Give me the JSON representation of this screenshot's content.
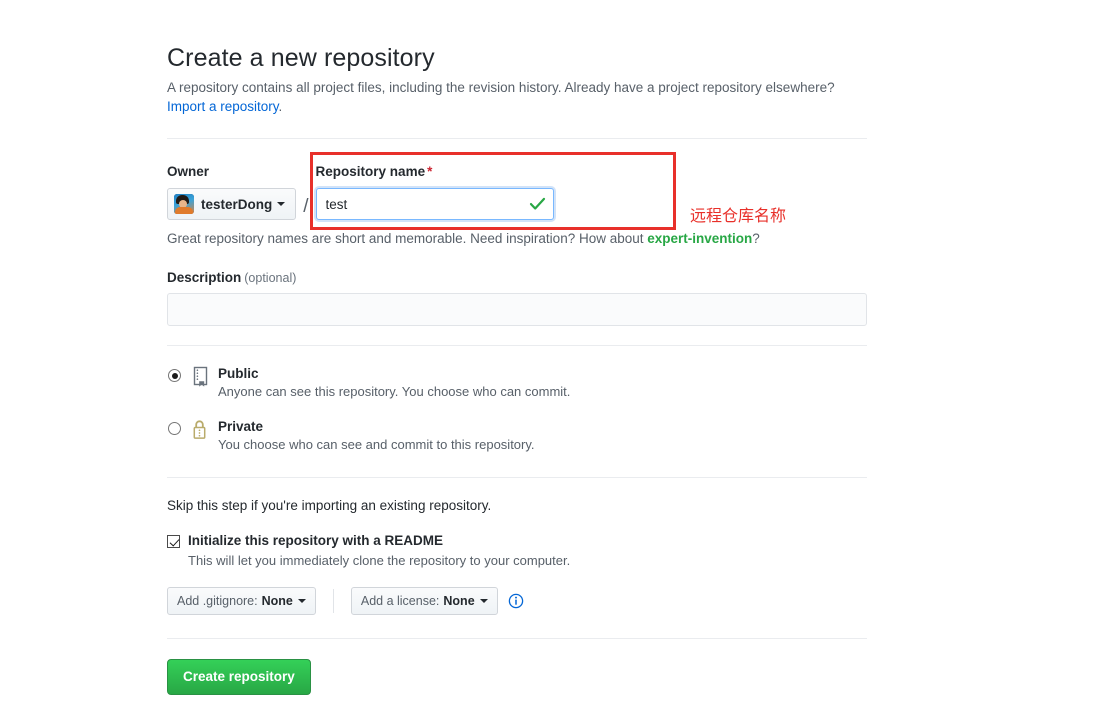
{
  "header": {
    "title": "Create a new repository",
    "subtitle": "A repository contains all project files, including the revision history. Already have a project repository elsewhere?",
    "import_link": "Import a repository",
    "import_period": "."
  },
  "owner": {
    "label": "Owner",
    "name": "testerDong"
  },
  "repo_name": {
    "label": "Repository name",
    "required_mark": "*",
    "value": "test",
    "placeholder": "",
    "valid_icon": "check-icon"
  },
  "annotation": {
    "text": "远程仓库名称",
    "color": "#e8302a"
  },
  "hint": {
    "prefix": "Great repository names are short and memorable. Need inspiration? How about ",
    "suggestion": "expert-invention",
    "suffix": "?"
  },
  "description": {
    "label": "Description",
    "optional": "(optional)",
    "value": "",
    "placeholder": ""
  },
  "visibility": {
    "options": [
      {
        "name": "Public",
        "description": "Anyone can see this repository. You choose who can commit.",
        "icon": "repo-icon",
        "selected": true
      },
      {
        "name": "Private",
        "description": "You choose who can see and commit to this repository.",
        "icon": "lock-icon",
        "selected": false
      }
    ]
  },
  "initialize": {
    "skip_text": "Skip this step if you're importing an existing repository.",
    "checkbox_label": "Initialize this repository with a README",
    "checkbox_checked": true,
    "checkbox_description": "This will let you immediately clone the repository to your computer.",
    "gitignore_prefix": "Add .gitignore:",
    "gitignore_value": "None",
    "license_prefix": "Add a license:",
    "license_value": "None",
    "info_icon": "info-icon"
  },
  "submit": {
    "label": "Create repository",
    "color": "#28a745"
  }
}
